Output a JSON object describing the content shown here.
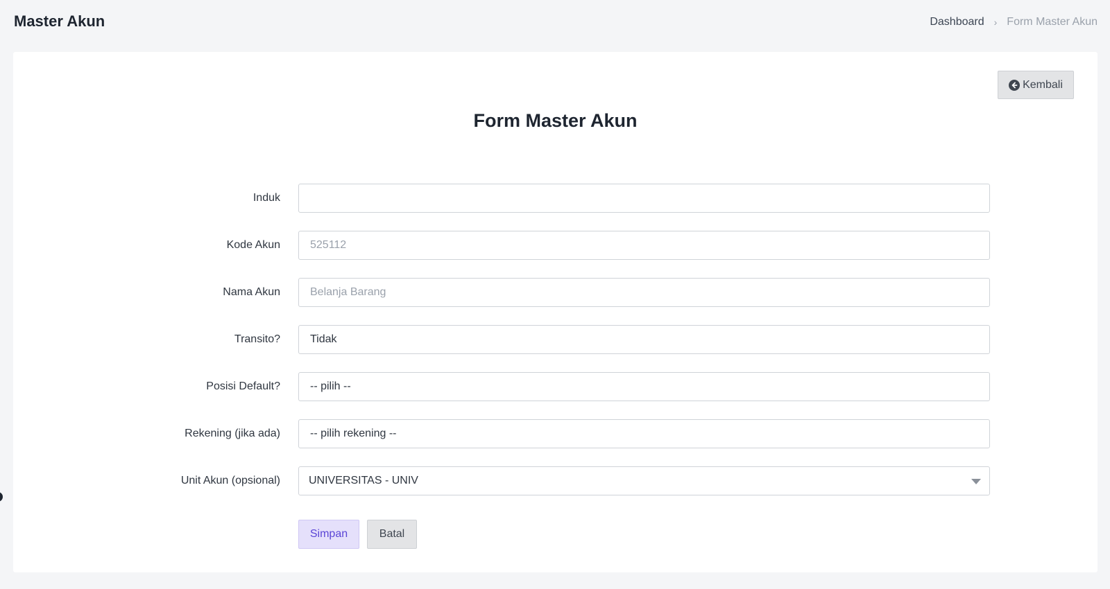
{
  "header": {
    "title": "Master Akun",
    "breadcrumb": {
      "home": "Dashboard",
      "separator": "›",
      "current": "Form Master Akun"
    }
  },
  "card": {
    "back_label": "Kembali",
    "back_icon": "arrow-circle-left-icon",
    "form_title": "Form Master Akun"
  },
  "form": {
    "induk": {
      "label": "Induk",
      "value": "",
      "placeholder": ""
    },
    "kode_akun": {
      "label": "Kode Akun",
      "value": "",
      "placeholder": "525112"
    },
    "nama_akun": {
      "label": "Nama Akun",
      "value": "",
      "placeholder": "Belanja Barang"
    },
    "transito": {
      "label": "Transito?",
      "selected": "Tidak"
    },
    "posisi_default": {
      "label": "Posisi Default?",
      "selected": "-- pilih --"
    },
    "rekening": {
      "label": "Rekening (jika ada)",
      "selected": "-- pilih rekening --"
    },
    "unit_akun": {
      "label": "Unit Akun (opsional)",
      "selected": "UNIVERSITAS - UNIV"
    }
  },
  "actions": {
    "save_label": "Simpan",
    "cancel_label": "Batal"
  },
  "colors": {
    "primary_text": "#5b45d6",
    "primary_bg": "#e5e0fb",
    "page_bg": "#f4f5f7"
  }
}
